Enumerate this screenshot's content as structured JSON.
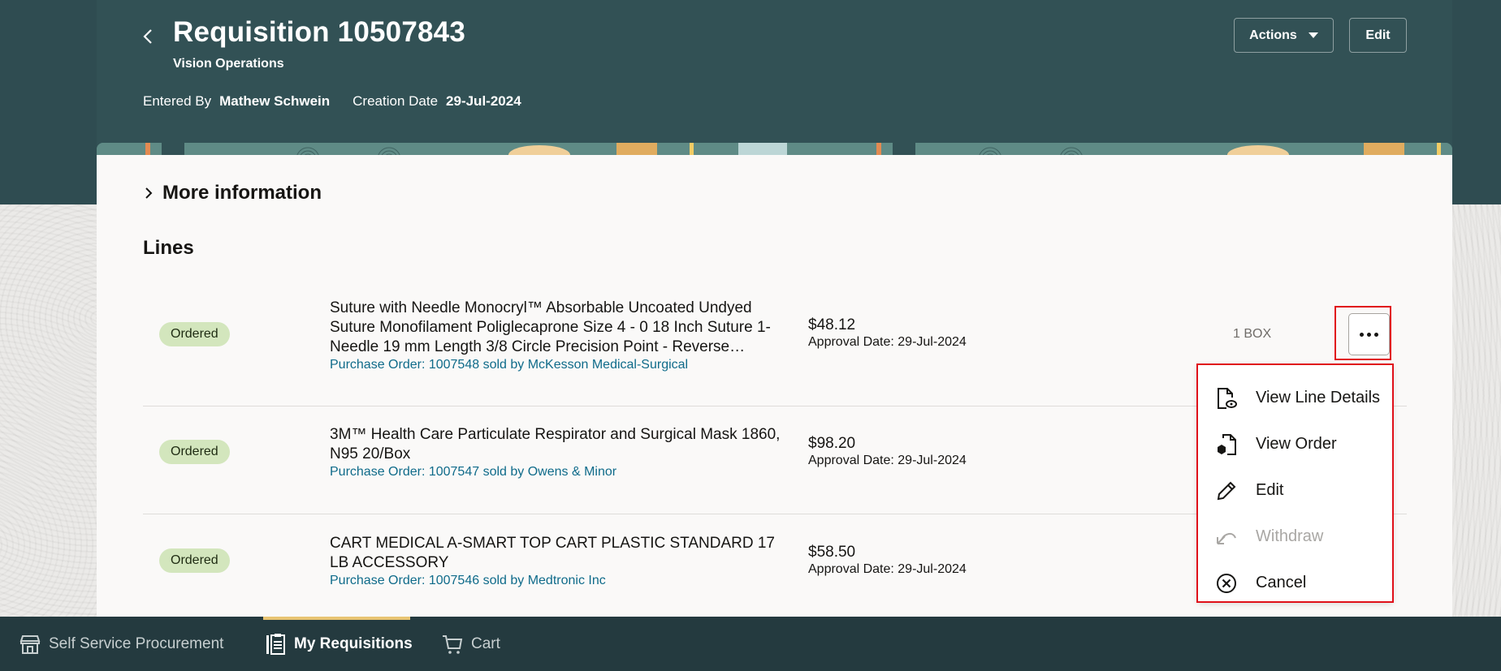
{
  "header": {
    "title": "Requisition 10507843",
    "subtitle": "Vision Operations",
    "entered_by_label": "Entered By",
    "entered_by_value": "Mathew Schwein",
    "creation_date_label": "Creation Date",
    "creation_date_value": "29-Jul-2024",
    "actions_label": "Actions",
    "edit_label": "Edit",
    "back_icon": "chevron-left-icon"
  },
  "sections": {
    "more_information": "More information",
    "lines_heading": "Lines"
  },
  "lines": [
    {
      "status": "Ordered",
      "title": "Suture with Needle Monocryl™ Absorbable Uncoated Undyed Suture Monofilament Poliglecaprone Size 4 - 0 18 Inch Suture 1-Needle 19 mm Length 3/8 Circle Precision Point - Reverse…",
      "po": "Purchase Order: 1007548 sold by McKesson Medical-Surgical",
      "price": "$48.12",
      "approval": "Approval Date: 29-Jul-2024",
      "quantity": "1 BOX"
    },
    {
      "status": "Ordered",
      "title": "3M™ Health Care Particulate Respirator and Surgical Mask 1860, N95 20/Box",
      "po": "Purchase Order: 1007547 sold by Owens & Minor",
      "price": "$98.20",
      "approval": "Approval Date: 29-Jul-2024",
      "quantity": ""
    },
    {
      "status": "Ordered",
      "title": "CART MEDICAL A-SMART TOP CART PLASTIC STANDARD 17 LB ACCESSORY",
      "po": "Purchase Order: 1007546 sold by Medtronic Inc",
      "price": "$58.50",
      "approval": "Approval Date: 29-Jul-2024",
      "quantity": ""
    }
  ],
  "overflow_menu": {
    "button_icon": "more-horizontal-icon",
    "items": [
      {
        "label": "View Line Details",
        "icon": "document-view-icon",
        "disabled": false
      },
      {
        "label": "View Order",
        "icon": "document-order-icon",
        "disabled": false
      },
      {
        "label": "Edit",
        "icon": "pencil-icon",
        "disabled": false
      },
      {
        "label": "Withdraw",
        "icon": "undo-icon",
        "disabled": true
      },
      {
        "label": "Cancel",
        "icon": "cancel-circle-icon",
        "disabled": false
      }
    ]
  },
  "bottom_nav": {
    "items": [
      {
        "label": "Self Service Procurement",
        "icon": "store-icon",
        "active": false
      },
      {
        "label": "My Requisitions",
        "icon": "clipboard-icon",
        "active": true
      },
      {
        "label": "Cart",
        "icon": "cart-icon",
        "active": false
      }
    ]
  },
  "colors": {
    "header_bg": "#325155",
    "status_badge_bg": "#d3e6bd",
    "link": "#0f6b8a",
    "nav_bg": "#243a3f",
    "nav_active_indicator": "#e8c472",
    "highlight": "#e0101a"
  }
}
